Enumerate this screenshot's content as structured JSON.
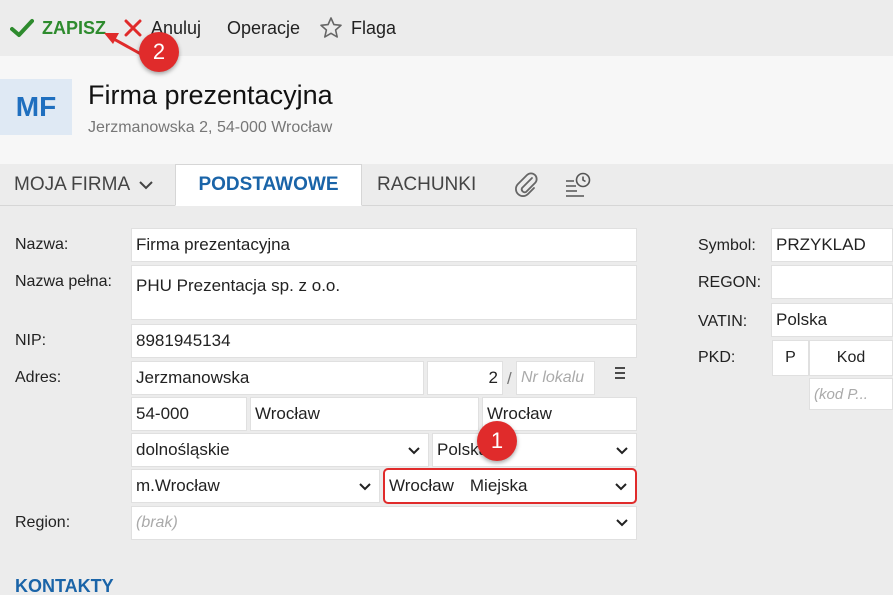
{
  "toolbar": {
    "save_label": "ZAPISZ",
    "cancel_label": "Anuluj",
    "operations_label": "Operacje",
    "flag_label": "Flaga"
  },
  "header": {
    "avatar_initials": "MF",
    "title": "Firma prezentacyjna",
    "subtitle": "Jerzmanowska 2, 54-000 Wrocław"
  },
  "tabs": {
    "moja_firma": "MOJA FIRMA",
    "podstawowe": "PODSTAWOWE",
    "rachunki": "RACHUNKI"
  },
  "form": {
    "nazwa_label": "Nazwa:",
    "nazwa_value": "Firma prezentacyjna",
    "nazwa_pelna_label": "Nazwa pełna:",
    "nazwa_pelna_value": "PHU Prezentacja sp. z o.o.",
    "nip_label": "NIP:",
    "nip_value": "8981945134",
    "adres_label": "Adres:",
    "ulica_value": "Jerzmanowska",
    "nr_domu_value": "2",
    "slash": "/",
    "nr_lokalu_placeholder": "Nr lokalu",
    "kod_pocztowy_value": "54-000",
    "miejscowosc_value": "Wrocław",
    "poczta_value": "Wrocław",
    "wojewodztwo_value": "dolnośląskie",
    "kraj_value": "Polska",
    "powiat_value": "m.Wrocław",
    "gmina_value": "Wrocław",
    "gmina_type_value": "Miejska",
    "region_label": "Region:",
    "region_value": "(brak)"
  },
  "right": {
    "symbol_label": "Symbol:",
    "symbol_value": "PRZYKLAD",
    "regon_label": "REGON:",
    "regon_value": "",
    "vatin_label": "VATIN:",
    "vatin_value": "Polska",
    "pkd_label": "PKD:",
    "pkd_col_p": "P",
    "pkd_col_kod": "Kod",
    "pkd_placeholder": "(kod P..."
  },
  "sections": {
    "kontakty": "KONTAKTY"
  },
  "annotations": {
    "badge_1": "1",
    "badge_2": "2"
  },
  "colors": {
    "accent_blue": "#1a64a8",
    "save_green": "#2e8b2e",
    "annotation_red": "#e02b2b"
  }
}
